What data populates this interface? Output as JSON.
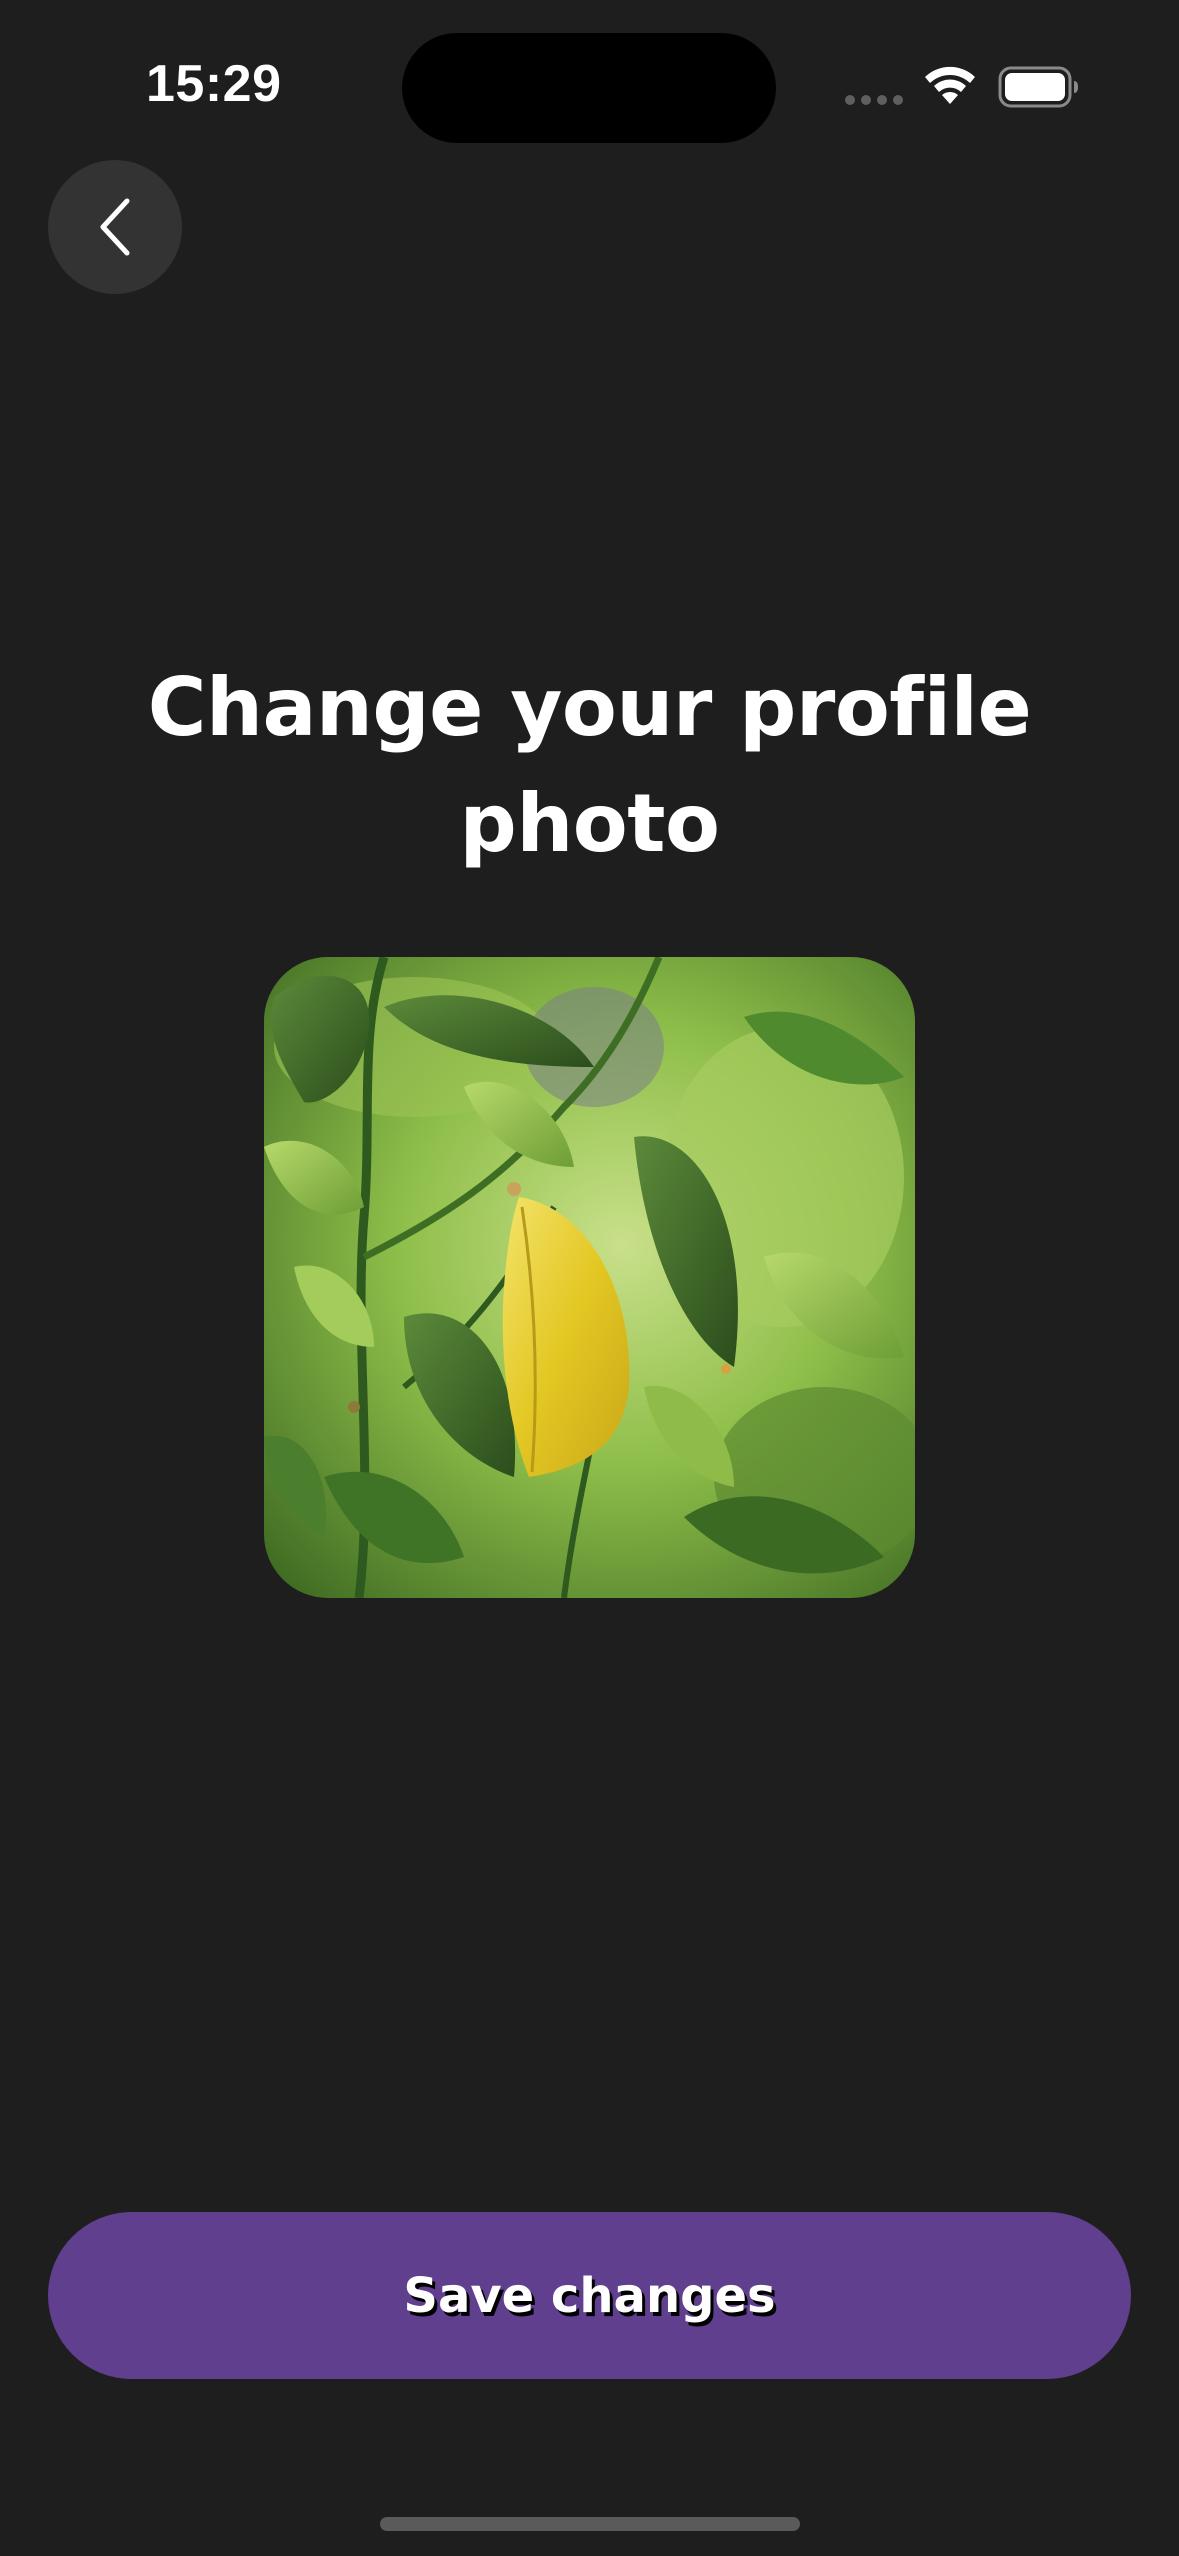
{
  "status_bar": {
    "time": "15:29"
  },
  "back_button": {
    "icon": "chevron-left-icon"
  },
  "page": {
    "title": "Change your profile photo"
  },
  "profile_photo": {
    "alt": "green leaves with one yellow leaf"
  },
  "actions": {
    "save_label": "Save changes"
  },
  "colors": {
    "background": "#1e1e1e",
    "primary_button": "#5f3f8e",
    "back_button_bg": "#333333",
    "text": "#ffffff"
  }
}
